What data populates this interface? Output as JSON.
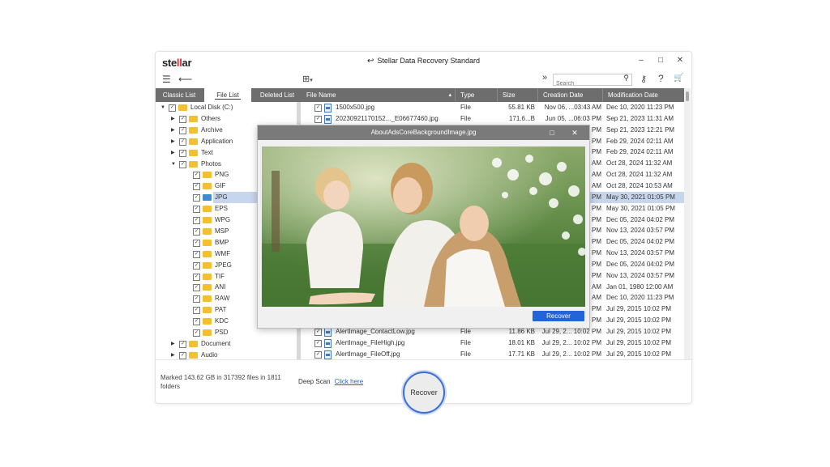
{
  "app": {
    "logo_prefix": "ste",
    "logo_highlight": "ll",
    "logo_suffix": "ar",
    "title": "Stellar Data Recovery Standard",
    "undo_glyph": "↩"
  },
  "window_controls": {
    "minimize": "–",
    "maximize": "□",
    "close": "✕"
  },
  "toolbar": {
    "menu_glyph": "☰",
    "back_glyph": "⟵",
    "view_glyph": "⊞",
    "view_caret": "▾",
    "expand_glyph": "»",
    "search_placeholder": "Search",
    "search_glyph": "⚲",
    "key_glyph": "⚷",
    "help_glyph": "?",
    "cart_glyph": "🛒"
  },
  "tree_tabs": [
    {
      "label": "Classic List"
    },
    {
      "label": "File List"
    },
    {
      "label": "Deleted List"
    }
  ],
  "tree": [
    {
      "label": "Local Disk (C:)",
      "level": 0,
      "expanded": true
    },
    {
      "label": "Others",
      "level": 1,
      "expanded": false
    },
    {
      "label": "Archive",
      "level": 1,
      "expanded": false
    },
    {
      "label": "Application",
      "level": 1,
      "expanded": false
    },
    {
      "label": "Text",
      "level": 1,
      "expanded": false
    },
    {
      "label": "Photos",
      "level": 1,
      "expanded": true
    },
    {
      "label": "PNG",
      "level": 2
    },
    {
      "label": "GIF",
      "level": 2
    },
    {
      "label": "JPG",
      "level": 2,
      "selected": true
    },
    {
      "label": "EPS",
      "level": 2
    },
    {
      "label": "WPG",
      "level": 2
    },
    {
      "label": "MSP",
      "level": 2
    },
    {
      "label": "BMP",
      "level": 2
    },
    {
      "label": "WMF",
      "level": 2
    },
    {
      "label": "JPEG",
      "level": 2
    },
    {
      "label": "TIF",
      "level": 2
    },
    {
      "label": "ANI",
      "level": 2
    },
    {
      "label": "RAW",
      "level": 2
    },
    {
      "label": "PAT",
      "level": 2
    },
    {
      "label": "KDC",
      "level": 2
    },
    {
      "label": "PSD",
      "level": 2
    },
    {
      "label": "Document",
      "level": 1,
      "expanded": false
    },
    {
      "label": "Audio",
      "level": 1,
      "expanded": false
    }
  ],
  "table": {
    "columns": [
      {
        "label": "File Name",
        "sort": "▴"
      },
      {
        "label": "Type"
      },
      {
        "label": "Size"
      },
      {
        "label": "Creation Date"
      },
      {
        "label": "Modification Date"
      }
    ],
    "rows": [
      {
        "name": "1500x500.jpg",
        "type": "File",
        "size": "55.81 KB",
        "created": "Nov 06, ...03:43 AM",
        "modified": "Dec 10, 2020 11:23 PM"
      },
      {
        "name": "20230921170152..._E06677460.jpg",
        "type": "File",
        "size": "171.6...B",
        "created": "Jun 05, ...06:03 PM",
        "modified": "Sep 21, 2023 11:31 AM"
      },
      {
        "name": "",
        "type": "",
        "size": "",
        "created": "PM",
        "modified": "Sep 21, 2023 12:21 PM"
      },
      {
        "name": "",
        "type": "",
        "size": "",
        "created": "PM",
        "modified": "Feb 29, 2024 02:11 AM"
      },
      {
        "name": "",
        "type": "",
        "size": "",
        "created": "PM",
        "modified": "Feb 29, 2024 02:11 AM"
      },
      {
        "name": "",
        "type": "",
        "size": "",
        "created": "AM",
        "modified": "Oct 28, 2024 11:32 AM"
      },
      {
        "name": "",
        "type": "",
        "size": "",
        "created": "AM",
        "modified": "Oct 28, 2024 11:32 AM"
      },
      {
        "name": "",
        "type": "",
        "size": "",
        "created": "AM",
        "modified": "Oct 28, 2024 10:53 AM"
      },
      {
        "name": "",
        "type": "",
        "size": "",
        "created": "PM",
        "modified": "May 30, 2021 01:05 PM",
        "selected": true
      },
      {
        "name": "",
        "type": "",
        "size": "",
        "created": "PM",
        "modified": "May 30, 2021 01:05 PM"
      },
      {
        "name": "",
        "type": "",
        "size": "",
        "created": "PM",
        "modified": "Dec 05, 2024 04:02 PM"
      },
      {
        "name": "",
        "type": "",
        "size": "",
        "created": "PM",
        "modified": "Nov 13, 2024 03:57 PM"
      },
      {
        "name": "",
        "type": "",
        "size": "",
        "created": "PM",
        "modified": "Dec 05, 2024 04:02 PM"
      },
      {
        "name": "",
        "type": "",
        "size": "",
        "created": "PM",
        "modified": "Nov 13, 2024 03:57 PM"
      },
      {
        "name": "",
        "type": "",
        "size": "",
        "created": "PM",
        "modified": "Dec 05, 2024 04:02 PM"
      },
      {
        "name": "",
        "type": "",
        "size": "",
        "created": "PM",
        "modified": "Nov 13, 2024 03:57 PM"
      },
      {
        "name": "",
        "type": "",
        "size": "",
        "created": "AM",
        "modified": "Jan 01, 1980 12:00 AM"
      },
      {
        "name": "",
        "type": "",
        "size": "",
        "created": "AM",
        "modified": "Dec 10, 2020 11:23 PM"
      },
      {
        "name": "",
        "type": "",
        "size": "",
        "created": "PM",
        "modified": "Jul 29, 2015 10:02 PM"
      },
      {
        "name": "",
        "type": "",
        "size": "",
        "created": "PM",
        "modified": "Jul 29, 2015 10:02 PM"
      },
      {
        "name": "AlertImage_ContactLow.jpg",
        "type": "File",
        "size": "11.86 KB",
        "created": "Jul 29, 2... 10:02 PM",
        "modified": "Jul 29, 2015 10:02 PM"
      },
      {
        "name": "AlertImage_FileHigh.jpg",
        "type": "File",
        "size": "18.01 KB",
        "created": "Jul 29, 2... 10:02 PM",
        "modified": "Jul 29, 2015 10:02 PM"
      },
      {
        "name": "AlertImage_FileOff.jpg",
        "type": "File",
        "size": "17.71 KB",
        "created": "Jul 29, 2... 10:02 PM",
        "modified": "Jul 29, 2015 10:02 PM"
      }
    ]
  },
  "preview": {
    "title": "AboutAdsCoreBackgroundImage.jpg",
    "maximize": "□",
    "close": "✕",
    "recover_label": "Recover"
  },
  "footer": {
    "marked_text": "Marked 143.62 GB in 317392 files in 1811 folders",
    "deep_scan_label": "Deep Scan",
    "deep_scan_link": "Click here",
    "recover_label": "Recover"
  },
  "colors": {
    "header_gray": "#6d6d6d",
    "selection": "#c7d6ec",
    "accent_blue": "#2563d8",
    "folder_yellow": "#f3c032",
    "logo_red": "#d9282f"
  }
}
